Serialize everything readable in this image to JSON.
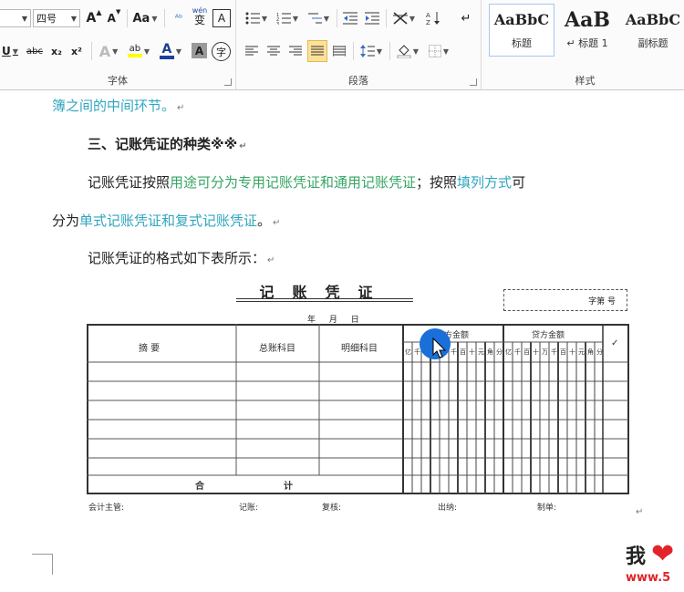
{
  "ribbon": {
    "font_group": {
      "label": "字体",
      "font_size_value": "四号",
      "grow_font": "A",
      "shrink_font": "A",
      "change_case": "Aa",
      "pinyin": "wén",
      "pinyin_base": "变",
      "char_border": "A",
      "underline": "U",
      "strikethrough": "abc",
      "subscript": "x₂",
      "superscript": "x²",
      "text_effect": "A",
      "highlight": "ab",
      "font_color": "A",
      "char_shading": "A",
      "enclose_char": "字"
    },
    "paragraph_group": {
      "label": "段落"
    },
    "styles_group": {
      "label": "样式",
      "styles": [
        {
          "sample": "AaBbC",
          "name": "标题"
        },
        {
          "sample": "AaB",
          "name": "↵ 标题 1"
        },
        {
          "sample": "AaBbC",
          "name": "副标题"
        }
      ]
    }
  },
  "document": {
    "line1": "簿之间的中间环节。",
    "heading": "三、记账凭证的种类※※",
    "p2_a": "记账凭证按照",
    "p2_b": "用途可分为专用记账凭证和通用记账凭证",
    "p2_c": "；按照",
    "p2_d": "填列方式",
    "p2_e": "可",
    "p3_a": "分为",
    "p3_b": "单式记账凭证和复式记账凭证",
    "p3_c": "。",
    "p4": "记账凭证的格式如下表所示：",
    "para_mark": "↵"
  },
  "voucher": {
    "title": "记账凭证",
    "number_label": "字第    号",
    "date_label": "年   月   日",
    "col_summary": "摘    要",
    "col_general": "总账科目",
    "col_detail": "明细科目",
    "col_debit": "借方金额",
    "col_credit": "贷方金额",
    "col_check": "✓",
    "digit_units": "亿千百十万千百十元角分",
    "total_a": "合",
    "total_b": "计",
    "footer": {
      "supervisor": "会计主管:",
      "bookkeeper": "记账:",
      "reviewer": "复核:",
      "cashier": "出纳:",
      "maker": "制单:"
    }
  },
  "watermark": {
    "text": "我",
    "heart": "❤",
    "url": "www.5"
  }
}
